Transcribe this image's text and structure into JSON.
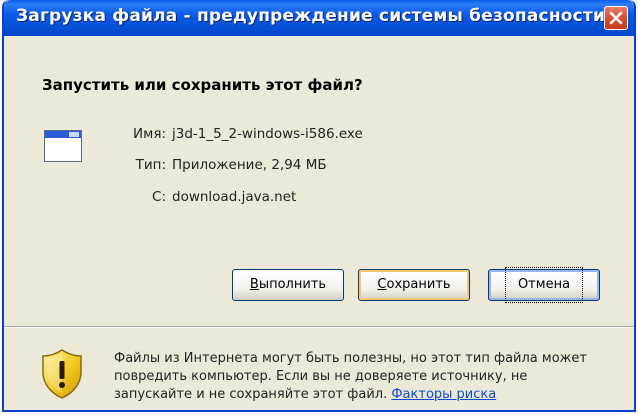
{
  "window": {
    "title": "Загрузка файла - предупреждение системы безопасности",
    "accent": "#0a5ee8",
    "close_icon": "close-icon"
  },
  "question": "Запустить или сохранить этот файл?",
  "file": {
    "icon": "application-window-icon",
    "name_label": "Имя:",
    "name_value": "j3d-1_5_2-windows-i586.exe",
    "type_label": "Тип:",
    "type_value": "Приложение, 2,94 МБ",
    "from_label": "С:",
    "from_value": "download.java.net"
  },
  "buttons": {
    "run_u": "В",
    "run_rest": "ыполнить",
    "save_u": "С",
    "save_rest": "охранить",
    "cancel": "Отмена"
  },
  "warning": {
    "icon": "shield-warning-icon",
    "text": "Файлы из Интернета могут быть полезны, но этот тип файла может повредить компьютер. Если вы не доверяете источнику, не запускайте и не сохраняйте этот файл. ",
    "link": "Факторы риска"
  }
}
